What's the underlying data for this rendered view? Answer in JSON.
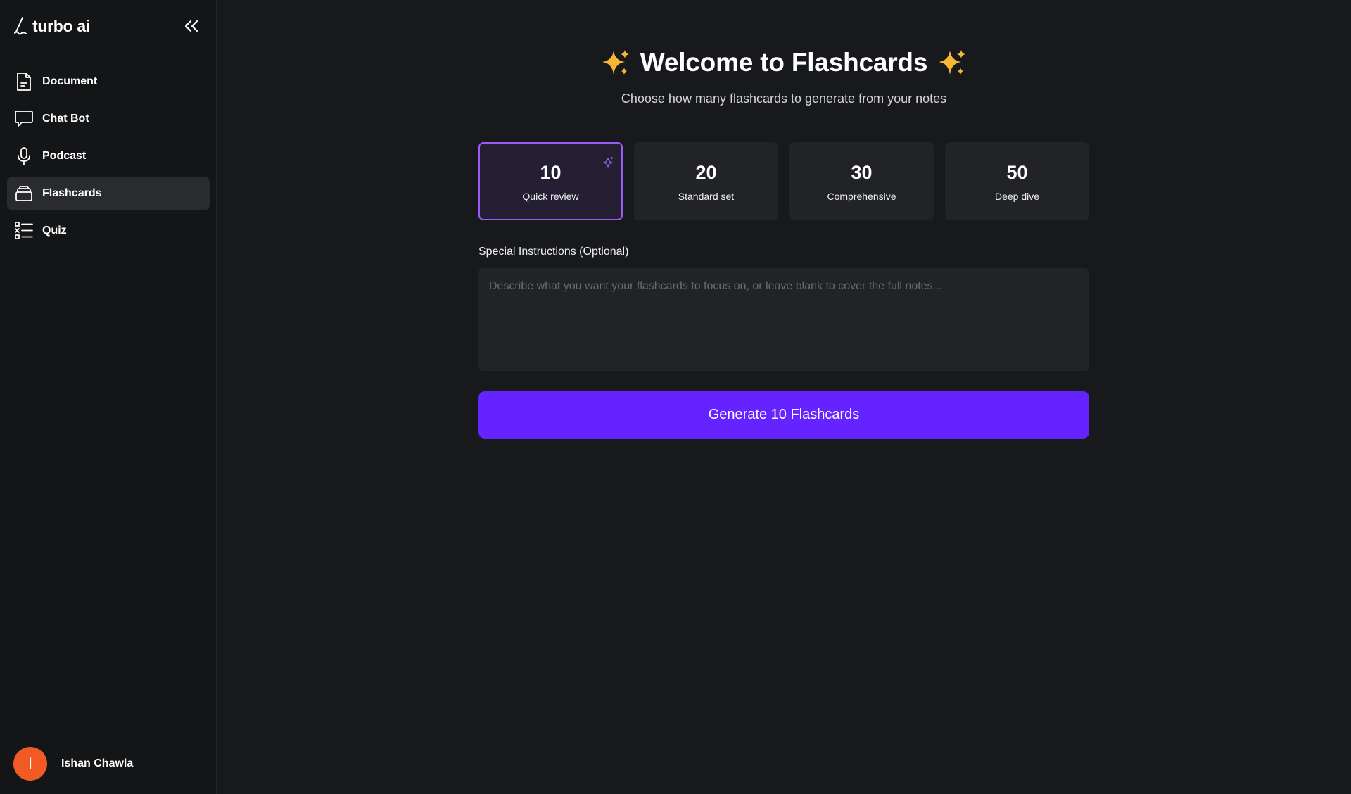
{
  "brand": {
    "name": "turbo ai"
  },
  "sidebar": {
    "items": [
      {
        "label": "Document",
        "icon": "document-icon",
        "active": false
      },
      {
        "label": "Chat Bot",
        "icon": "chat-icon",
        "active": false
      },
      {
        "label": "Podcast",
        "icon": "microphone-icon",
        "active": false
      },
      {
        "label": "Flashcards",
        "icon": "flashcards-icon",
        "active": true
      },
      {
        "label": "Quiz",
        "icon": "quiz-list-icon",
        "active": false
      }
    ]
  },
  "user": {
    "name": "Ishan Chawla",
    "avatar_initial": "I",
    "avatar_color": "#f15a24"
  },
  "main": {
    "title": "Welcome to Flashcards",
    "subtitle": "Choose how many flashcards to generate from your notes",
    "options": [
      {
        "count": "10",
        "label": "Quick review",
        "selected": true
      },
      {
        "count": "20",
        "label": "Standard set",
        "selected": false
      },
      {
        "count": "30",
        "label": "Comprehensive",
        "selected": false
      },
      {
        "count": "50",
        "label": "Deep dive",
        "selected": false
      }
    ],
    "instructions": {
      "label": "Special Instructions (Optional)",
      "placeholder": "Describe what you want your flashcards to focus on, or leave blank to cover the full notes...",
      "value": ""
    },
    "generate_label": "Generate 10 Flashcards"
  },
  "colors": {
    "accent": "#6423ff",
    "selected_border": "#9b5cf6",
    "sparkle": "#f7b733",
    "background": "#18191d",
    "sidebar": "#141517"
  }
}
